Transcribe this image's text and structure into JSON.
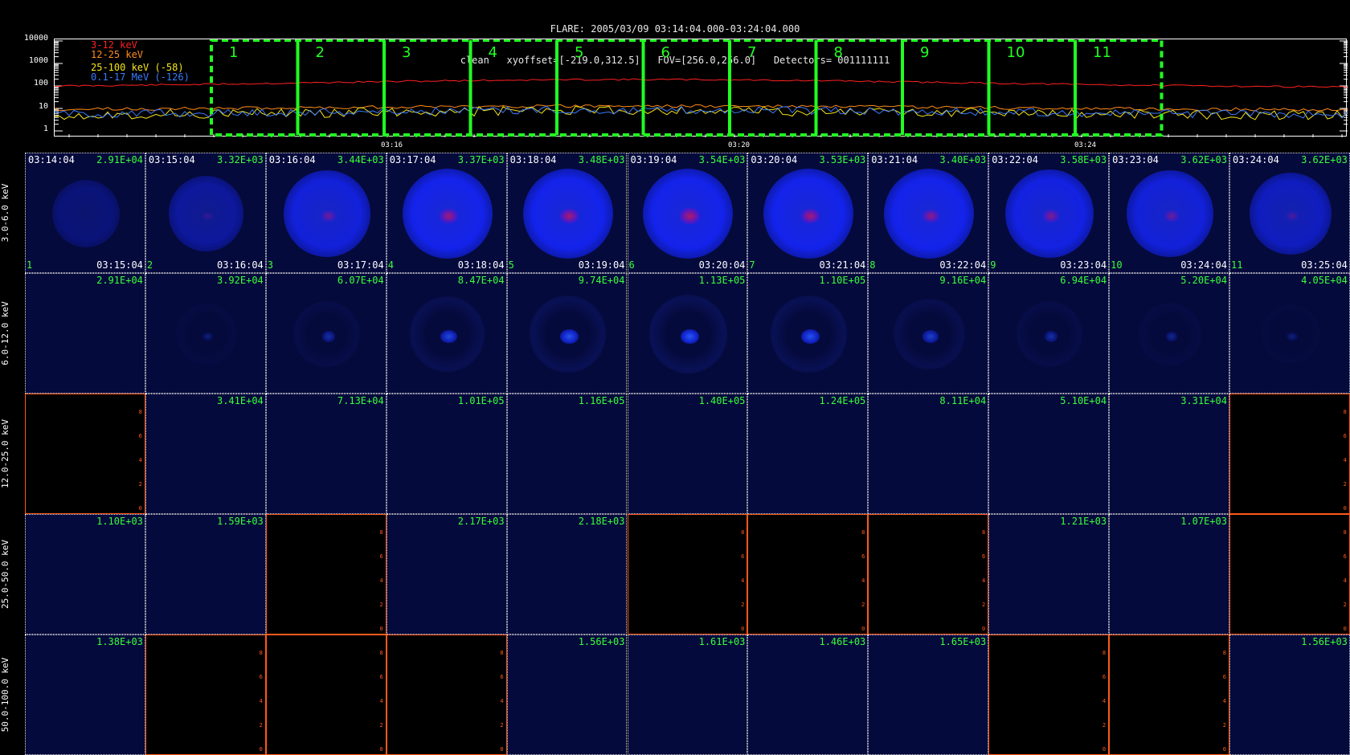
{
  "header": {
    "line1": "FLARE: 2005/03/09 03:14:04.000-03:24:04.000",
    "line2": "clean   xyoffset=[-219.0,312.5]   FOV=[256.0,256.0]   Detectors= 001111111"
  },
  "lightcurve": {
    "y_ticks": [
      "10000",
      "1000",
      "100",
      "10",
      "1"
    ],
    "legend": [
      {
        "label": "3-12 keV",
        "color": "#ff2020"
      },
      {
        "label": "12-25 keV",
        "color": "#ff8c1a"
      },
      {
        "label": "25-100 keV (-58)",
        "color": "#f5e51b"
      },
      {
        "label": "0.1-17 MeV (-126)",
        "color": "#3a7bff"
      }
    ],
    "intervals": [
      "1",
      "2",
      "3",
      "4",
      "5",
      "6",
      "7",
      "8",
      "9",
      "10",
      "11"
    ],
    "time_labels": [
      "03:16",
      "03:20",
      "03:24"
    ]
  },
  "energy_bands": [
    "3.0-6.0 keV",
    "6.0-12.0 keV",
    "12.0-25.0 keV",
    "25.0-50.0 keV",
    "50.0-100.0 keV"
  ],
  "start_times": [
    "03:14:04",
    "03:15:04",
    "03:16:04",
    "03:17:04",
    "03:18:04",
    "03:19:04",
    "03:20:04",
    "03:21:04",
    "03:22:04",
    "03:23:04",
    "03:24:04"
  ],
  "end_times": [
    "03:15:04",
    "03:16:04",
    "03:17:04",
    "03:18:04",
    "03:19:04",
    "03:20:04",
    "03:21:04",
    "03:22:04",
    "03:23:04",
    "03:24:04",
    "03:25:04"
  ],
  "flux": [
    [
      "2.91E+04",
      "3.32E+03",
      "3.44E+03",
      "3.37E+03",
      "3.48E+03",
      "3.54E+03",
      "3.53E+03",
      "3.40E+03",
      "3.58E+03",
      "3.62E+03",
      "3.62E+03"
    ],
    [
      "2.91E+04",
      "3.92E+04",
      "6.07E+04",
      "8.47E+04",
      "9.74E+04",
      "1.13E+05",
      "1.10E+05",
      "9.16E+04",
      "6.94E+04",
      "5.20E+04",
      "4.05E+04"
    ],
    [
      "",
      "3.41E+04",
      "7.13E+04",
      "1.01E+05",
      "1.16E+05",
      "1.40E+05",
      "1.24E+05",
      "8.11E+04",
      "5.10E+04",
      "3.31E+04",
      ""
    ],
    [
      "1.10E+03",
      "1.59E+03",
      "",
      "2.17E+03",
      "2.18E+03",
      "",
      "",
      "",
      "1.21E+03",
      "1.07E+03",
      ""
    ],
    [
      "1.38E+03",
      "",
      "",
      "",
      "1.56E+03",
      "1.61E+03",
      "1.46E+03",
      "1.65E+03",
      "",
      "",
      "1.56E+03"
    ]
  ],
  "axis_ticks": [
    "8",
    "6",
    "4",
    "2",
    "0"
  ],
  "colors": {
    "bg": "#000000",
    "flux": "#39ff39",
    "interval": "#22ff22",
    "axis_empty": "#ff5a1a"
  }
}
